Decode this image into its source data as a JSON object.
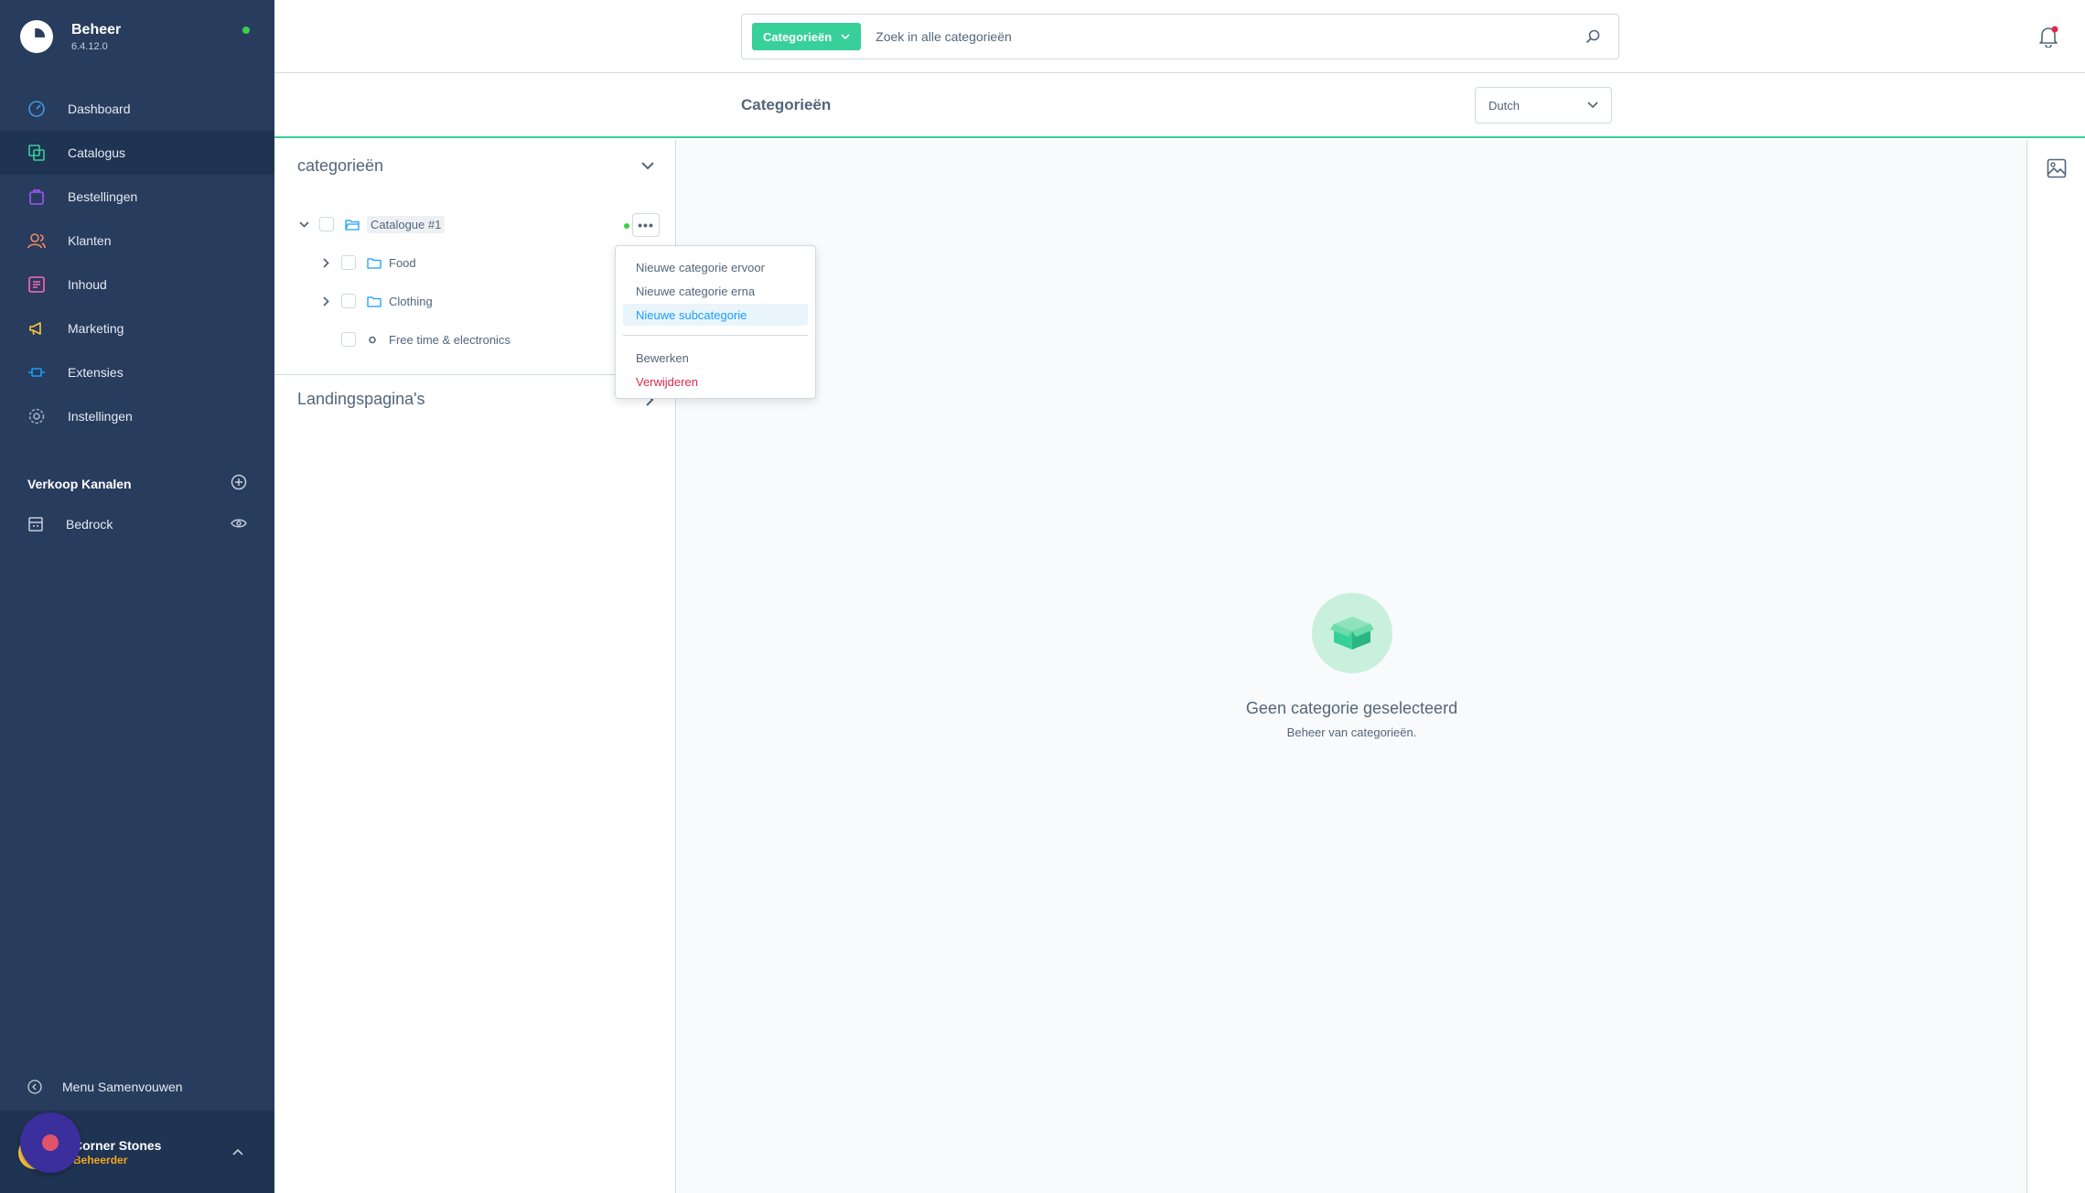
{
  "app": {
    "title": "Beheer",
    "version": "6.4.12.0"
  },
  "nav": {
    "items": [
      {
        "label": "Dashboard",
        "icon": "dashboard-icon"
      },
      {
        "label": "Catalogus",
        "icon": "catalog-icon",
        "active": true
      },
      {
        "label": "Bestellingen",
        "icon": "orders-icon"
      },
      {
        "label": "Klanten",
        "icon": "customers-icon"
      },
      {
        "label": "Inhoud",
        "icon": "content-icon"
      },
      {
        "label": "Marketing",
        "icon": "marketing-icon"
      },
      {
        "label": "Extensies",
        "icon": "extensions-icon"
      },
      {
        "label": "Instellingen",
        "icon": "settings-icon"
      }
    ],
    "channels_title": "Verkoop Kanalen",
    "channel": "Bedrock",
    "collapse_label": "Menu Samenvouwen"
  },
  "user": {
    "name": "Corner Stones",
    "role": "Beheerder"
  },
  "search": {
    "type_label": "Categorieën",
    "placeholder": "Zoek in alle categorieën"
  },
  "header": {
    "title": "Categorieën",
    "language": "Dutch"
  },
  "tree": {
    "title": "categorieën",
    "root": "Catalogue #1",
    "children": [
      "Food",
      "Clothing",
      "Free time & electronics"
    ],
    "landing_title": "Landingspagina's"
  },
  "context_menu": {
    "items": [
      "Nieuwe categorie ervoor",
      "Nieuwe categorie erna",
      "Nieuwe subcategorie"
    ],
    "edit": "Bewerken",
    "delete": "Verwijderen"
  },
  "empty": {
    "title": "Geen categorie geselecteerd",
    "subtitle": "Beheer van categorieën."
  },
  "colors": {
    "sidebar": "#283c5d",
    "accent": "#37d09a",
    "danger": "#de294c",
    "link": "#189eff"
  }
}
